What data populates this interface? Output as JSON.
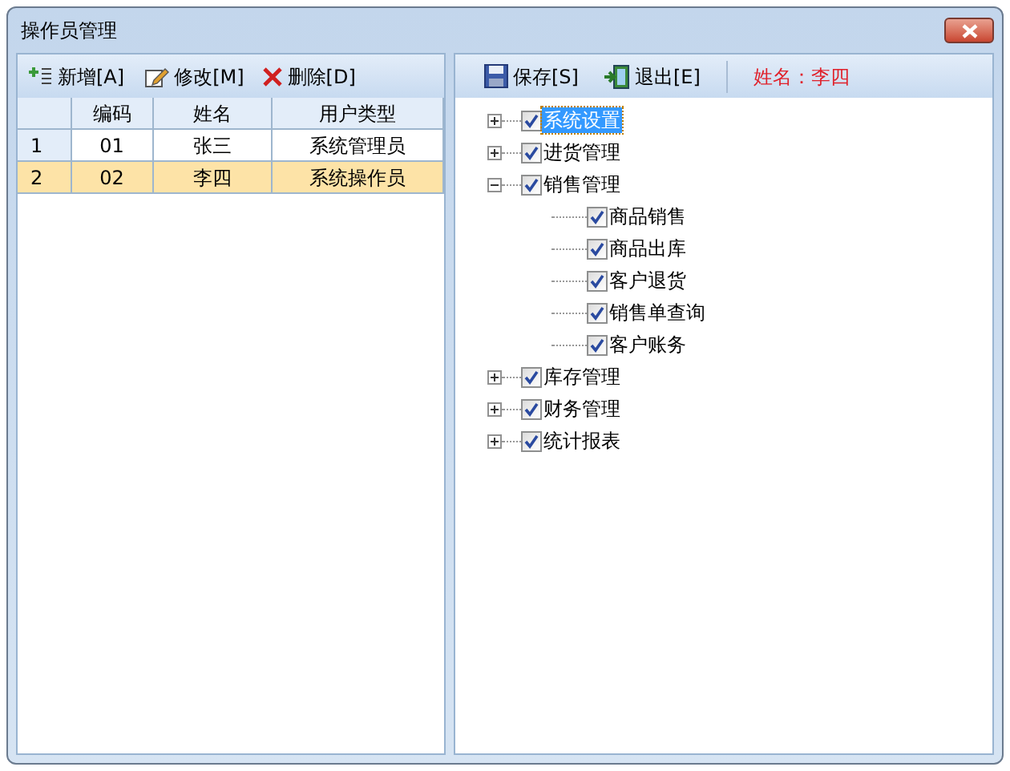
{
  "window": {
    "title": "操作员管理"
  },
  "left_toolbar": [
    {
      "kind": "add",
      "label": "新增[A]"
    },
    {
      "kind": "edit",
      "label": "修改[M]"
    },
    {
      "kind": "delete",
      "label": "删除[D]"
    }
  ],
  "table": {
    "columns": [
      "编码",
      "姓名",
      "用户类型"
    ],
    "rows": [
      {
        "index": "1",
        "cells": [
          "01",
          "张三",
          "系统管理员"
        ],
        "selected": false
      },
      {
        "index": "2",
        "cells": [
          "02",
          "李四",
          "系统操作员"
        ],
        "selected": true
      }
    ]
  },
  "right_toolbar": [
    {
      "kind": "save",
      "label": "保存[S]"
    },
    {
      "kind": "exit",
      "label": "退出[E]"
    }
  ],
  "current_user": "姓名：李四",
  "tree": [
    {
      "label": "系统设置",
      "checked": true,
      "expanded": false,
      "selected": true
    },
    {
      "label": "进货管理",
      "checked": true,
      "expanded": false,
      "selected": false
    },
    {
      "label": "销售管理",
      "checked": true,
      "expanded": true,
      "selected": false,
      "children": [
        {
          "label": "商品销售",
          "checked": true,
          "selected": false
        },
        {
          "label": "商品出库",
          "checked": true,
          "selected": false
        },
        {
          "label": "客户退货",
          "checked": true,
          "selected": false
        },
        {
          "label": "销售单查询",
          "checked": true,
          "selected": false
        },
        {
          "label": "客户账务",
          "checked": true,
          "selected": false
        }
      ]
    },
    {
      "label": "库存管理",
      "checked": true,
      "expanded": false,
      "selected": false
    },
    {
      "label": "财务管理",
      "checked": true,
      "expanded": false,
      "selected": false
    },
    {
      "label": "统计报表",
      "checked": true,
      "expanded": false,
      "selected": false
    }
  ]
}
